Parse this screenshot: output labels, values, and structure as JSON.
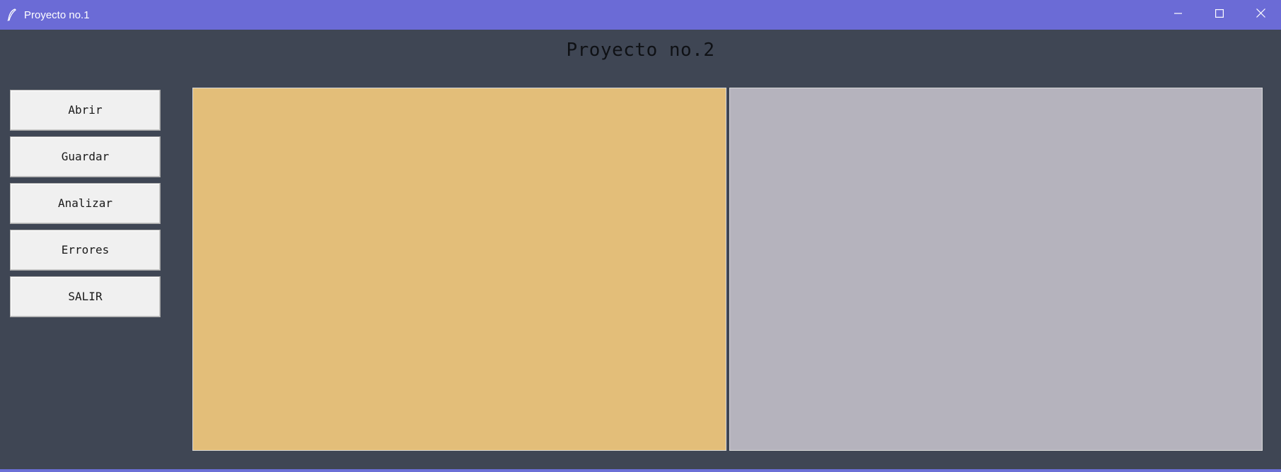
{
  "window": {
    "title": "Proyecto no.1",
    "icon": "feather-icon",
    "controls": {
      "minimize": "minimize-icon",
      "maximize": "maximize-icon",
      "close": "close-icon"
    },
    "titlebar_color": "#6b6bd6"
  },
  "main": {
    "heading": "Proyecto no.2",
    "background_color": "#3f4654"
  },
  "sidebar": {
    "buttons": [
      {
        "label": "Abrir"
      },
      {
        "label": "Guardar"
      },
      {
        "label": "Analizar"
      },
      {
        "label": "Errores"
      },
      {
        "label": "SALIR"
      }
    ]
  },
  "editors": {
    "input": {
      "value": "",
      "color": "#e3be79"
    },
    "output": {
      "value": "",
      "color": "#b5b3bd"
    }
  }
}
